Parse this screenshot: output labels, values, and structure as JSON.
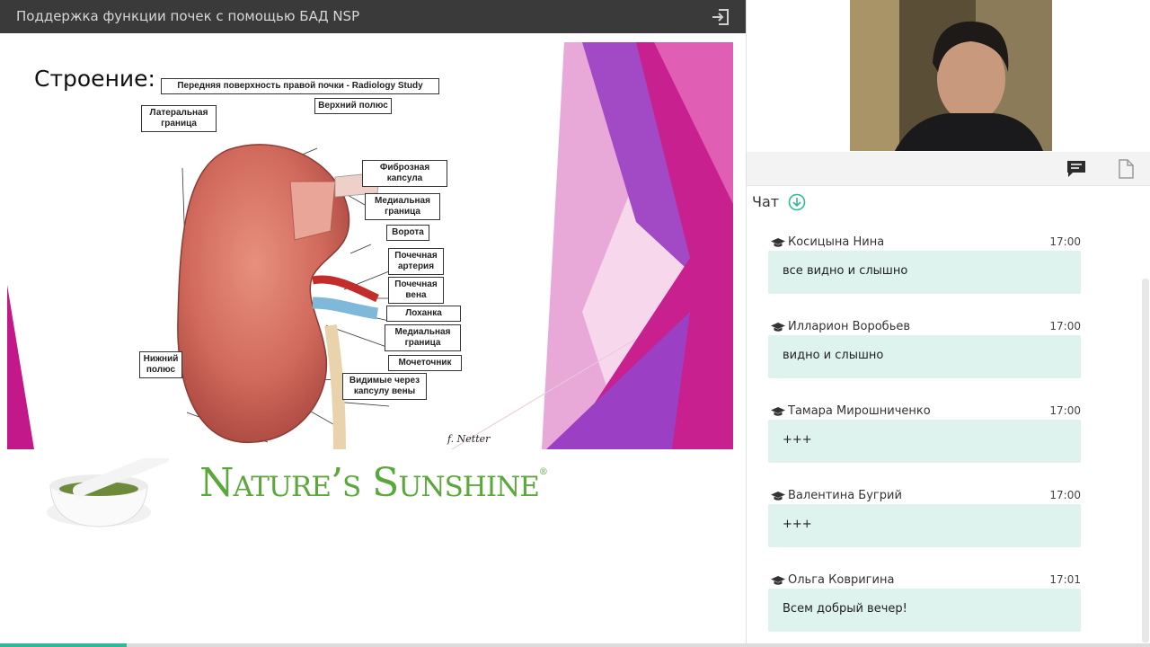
{
  "topbar": {
    "title": "Поддержка функции почек с помощью БАД NSP",
    "exit_icon": "exit-icon"
  },
  "slide": {
    "heading": "Строение:",
    "labels": {
      "title": "Передняя поверхность правой почки - Radiology Study",
      "lateral": "Латеральная граница",
      "upper_pole": "Верхний полюс",
      "fibrous": "Фиброзная капсула",
      "medial_border": "Медиальная граница",
      "hilum": "Ворота",
      "artery": "Почечная артерия",
      "vein": "Почечная вена",
      "pelvis": "Лоханка",
      "medial_border2": "Медиальная граница",
      "ureter": "Мочеточник",
      "lower_pole": "Нижний полюс",
      "visible_veins": "Видимые через капсулу вены"
    },
    "brand": "Nature’s Sunshine",
    "brand_mark": "®",
    "accent_colors": [
      "#c2188a",
      "#9b3fc4",
      "#e05fb4"
    ]
  },
  "progress": {
    "value_percent": 11,
    "color": "#2fb89a"
  },
  "right": {
    "tabs": {
      "chat_icon": "chat-icon",
      "document_icon": "document-icon"
    },
    "chat_title": "Чат",
    "messages": [
      {
        "author": "Косицына Нина",
        "time": "17:00",
        "text": "все видно и слышно"
      },
      {
        "author": "Илларион Воробьев",
        "time": "17:00",
        "text": "видно и слышно"
      },
      {
        "author": "Тамара Мирошниченко",
        "time": "17:00",
        "text": "+++"
      },
      {
        "author": "Валентина Бугрий",
        "time": "17:00",
        "text": "+++"
      },
      {
        "author": "Ольга Ковригина",
        "time": "17:01",
        "text": "Всем добрый вечер!"
      }
    ]
  }
}
